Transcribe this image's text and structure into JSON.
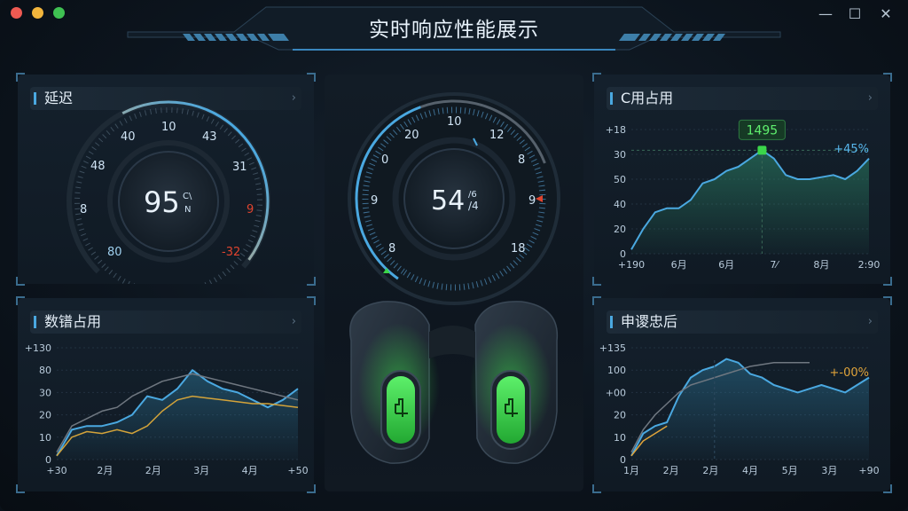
{
  "window": {
    "title": "实时响应性能展示",
    "controls": {
      "minimize": "—",
      "maximize": "☐",
      "close": "✕"
    }
  },
  "colors": {
    "accent": "#4aa8e0",
    "green": "#3bd64a",
    "orange": "#e0a43a",
    "red": "#e04a3a"
  },
  "latency": {
    "title": "延迟",
    "value": "95",
    "unit_top": "C\\",
    "unit_bottom": "N",
    "ticks": [
      "80",
      "8",
      "48",
      "40",
      "10",
      "43",
      "31",
      "9",
      "-32"
    ]
  },
  "center_gauge": {
    "value": "54",
    "unit_top": "/6",
    "unit_bottom": "/4",
    "ticks": [
      "8",
      "9",
      "0",
      "20",
      "10",
      "12",
      "8",
      "9",
      "18"
    ]
  },
  "cpu": {
    "title": "C用占用",
    "peak_label": "1495",
    "delta_label": "+45%"
  },
  "data_usage": {
    "title": "数镨占用"
  },
  "sched": {
    "title": "申谡忠后",
    "delta_label": "+-00%"
  },
  "chart_data": [
    {
      "type": "area",
      "title": "C用占用",
      "y_ticks": [
        "+18",
        "30",
        "50",
        "40",
        "20",
        "0"
      ],
      "x_ticks": [
        "+190",
        "6月",
        "6月",
        "7⁄",
        "8月",
        "2:90"
      ],
      "x": [
        0,
        1,
        2,
        3,
        4,
        5,
        6,
        7,
        8,
        9,
        10,
        11,
        12,
        13,
        14,
        15,
        16,
        17,
        18,
        19,
        20
      ],
      "series": [
        {
          "values": [
            2,
            12,
            20,
            22,
            22,
            26,
            34,
            36,
            40,
            42,
            46,
            50,
            46,
            38,
            36,
            36,
            37,
            38,
            36,
            40,
            46
          ]
        }
      ],
      "ylim": [
        0,
        60
      ],
      "annotations": [
        "1495",
        "+45%"
      ]
    },
    {
      "type": "line",
      "title": "数镨占用",
      "y_ticks": [
        "+130",
        "80",
        "30",
        "20",
        "10",
        "0"
      ],
      "x_ticks": [
        "+30",
        "2月",
        "2月",
        "3月",
        "4月",
        "+50"
      ],
      "x": [
        0,
        1,
        2,
        3,
        4,
        5,
        6,
        7,
        8,
        9,
        10,
        11,
        12,
        13,
        14,
        15,
        16
      ],
      "series": [
        {
          "values": [
            2,
            16,
            18,
            18,
            20,
            24,
            34,
            32,
            38,
            48,
            42,
            38,
            36,
            32,
            28,
            32,
            38
          ]
        },
        {
          "values": [
            2,
            12,
            15,
            14,
            16,
            14,
            18,
            26,
            32,
            34,
            33,
            32,
            31,
            30,
            30,
            29,
            28
          ]
        },
        {
          "values": [
            4,
            18,
            22,
            26,
            28,
            34,
            38,
            42,
            44,
            46,
            44,
            42,
            40,
            38,
            36,
            34,
            32
          ]
        }
      ],
      "ylim": [
        0,
        60
      ]
    },
    {
      "type": "area",
      "title": "申谡忠后",
      "y_ticks": [
        "+135",
        "100",
        "+00",
        "20",
        "10",
        "0"
      ],
      "x_ticks": [
        "1月",
        "2月",
        "2月",
        "4月",
        "5月",
        "3月",
        "+90"
      ],
      "x": [
        0,
        1,
        2,
        3,
        4,
        5,
        6,
        7,
        8,
        9,
        10,
        11,
        12,
        13,
        14,
        15,
        16,
        17,
        18,
        19,
        20
      ],
      "series": [
        {
          "values": [
            2,
            14,
            18,
            20,
            34,
            44,
            48,
            50,
            54,
            52,
            46,
            44,
            40,
            38,
            36,
            38,
            40,
            38,
            36,
            40,
            44
          ]
        },
        {
          "values": [
            2,
            10,
            14,
            18
          ]
        },
        {
          "values": [
            4,
            16,
            24,
            30,
            36,
            40,
            42,
            44,
            46,
            48,
            50,
            51,
            52,
            52,
            52,
            52
          ]
        }
      ],
      "ylim": [
        0,
        60
      ],
      "annotations": [
        "+-00%"
      ]
    }
  ]
}
